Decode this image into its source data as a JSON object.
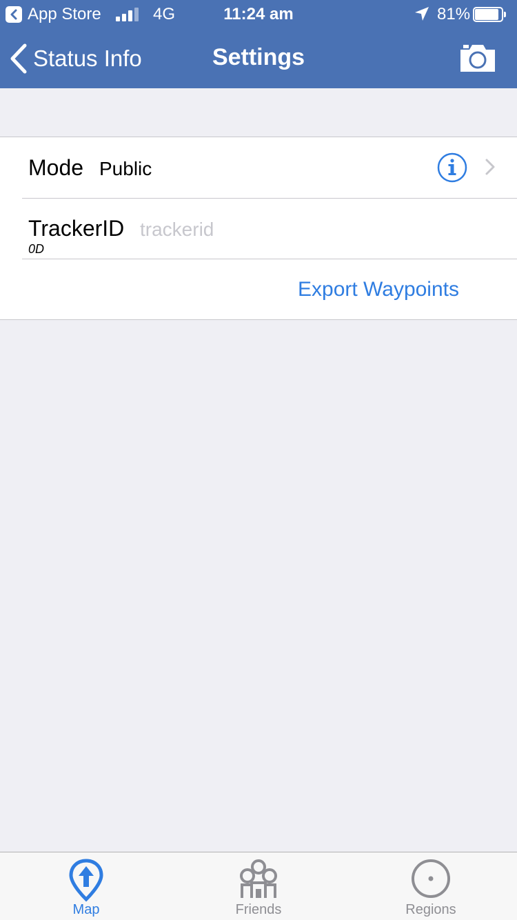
{
  "status_bar": {
    "back_app": "App Store",
    "network": "4G",
    "time": "11:24 am",
    "battery": "81%",
    "battery_level": 0.81,
    "signal_bars": 4
  },
  "nav": {
    "back_label": "Status Info",
    "title": "Settings",
    "back_icon": "chevron-left-icon",
    "action_icon": "camera-icon"
  },
  "settings": {
    "mode": {
      "label": "Mode",
      "value": "Public"
    },
    "tracker": {
      "label": "TrackerID",
      "placeholder": "trackerid",
      "value": "",
      "sublabel": "0D"
    },
    "export_label": "Export Waypoints"
  },
  "tabbar": {
    "tabs": [
      {
        "label": "Map",
        "icon": "map-pin-icon",
        "active": true
      },
      {
        "label": "Friends",
        "icon": "friends-icon",
        "active": false
      },
      {
        "label": "Regions",
        "icon": "regions-icon",
        "active": false
      }
    ]
  },
  "colors": {
    "nav_background": "#4a72b4",
    "accent": "#2f7de1",
    "background": "#efeff4",
    "inactive": "#8e8e93"
  }
}
